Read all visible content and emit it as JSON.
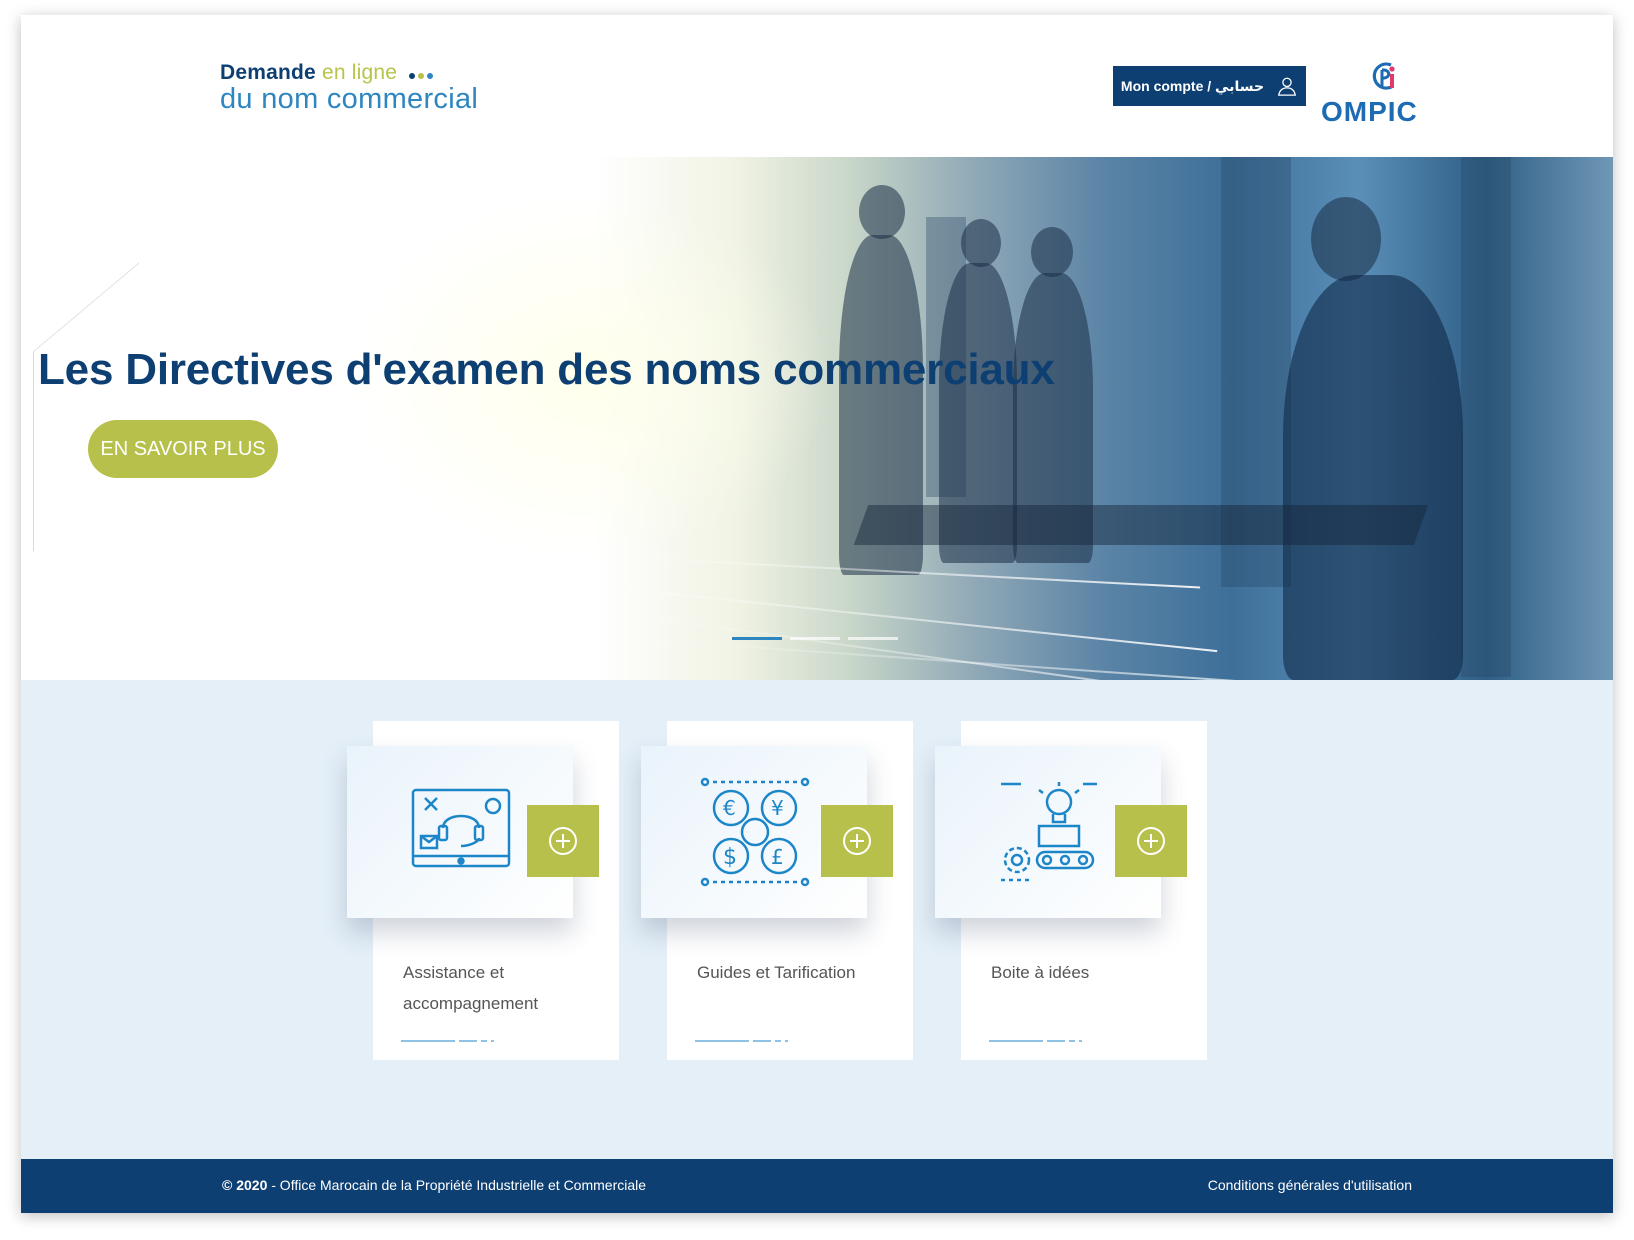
{
  "header": {
    "brand_line1_prefix": "Demande",
    "brand_line1_accent": "en ligne",
    "brand_line2": "du nom commercial",
    "account_label": "Mon compte / حسابي",
    "logo_text": "OMPIC",
    "colors": {
      "navy": "#0d3f73",
      "blue": "#2e86c1",
      "olive": "#b6c04a"
    }
  },
  "hero": {
    "title": "Les Directives d'examen des noms commerciaux",
    "cta_label": "EN SAVOIR PLUS",
    "slides_total": 3,
    "active_slide": 1
  },
  "services": {
    "cards": [
      {
        "label": "Assistance et accompagnement",
        "icon": "support-monitor-icon"
      },
      {
        "label": "Guides et Tarification",
        "icon": "currency-icon"
      },
      {
        "label": "Boite à idées",
        "icon": "idea-machine-icon"
      }
    ]
  },
  "footer": {
    "copyright_year": "© 2020",
    "copyright_text": " - Office Marocain de la Propriété Industrielle et Commerciale",
    "terms_label": "Conditions générales d'utilisation"
  }
}
